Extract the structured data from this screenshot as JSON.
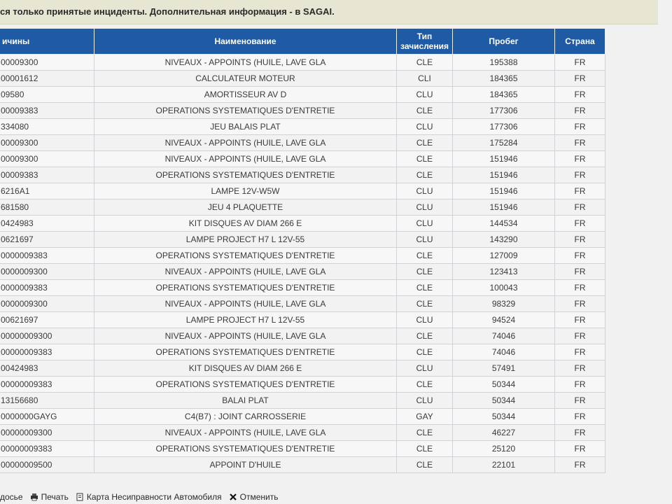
{
  "notice": "ся только принятые инциденты. Дополнительная информация - в SAGAI.",
  "table": {
    "headers": [
      "ичины",
      "Наименование",
      "Тип\nзачисления",
      "Пробег",
      "Страна"
    ],
    "rows": [
      [
        "00009300",
        "NIVEAUX - APPOINTS (HUILE, LAVE GLA",
        "CLE",
        "195388",
        "FR"
      ],
      [
        "00001612",
        "CALCULATEUR MOTEUR",
        "CLI",
        "184365",
        "FR"
      ],
      [
        "09580",
        "AMORTISSEUR AV D",
        "CLU",
        "184365",
        "FR"
      ],
      [
        "00009383",
        "OPERATIONS SYSTEMATIQUES D'ENTRETIE",
        "CLE",
        "177306",
        "FR"
      ],
      [
        "334080",
        "JEU BALAIS PLAT",
        "CLU",
        "177306",
        "FR"
      ],
      [
        "00009300",
        "NIVEAUX - APPOINTS (HUILE, LAVE GLA",
        "CLE",
        "175284",
        "FR"
      ],
      [
        "00009300",
        "NIVEAUX - APPOINTS (HUILE, LAVE GLA",
        "CLE",
        "151946",
        "FR"
      ],
      [
        "00009383",
        "OPERATIONS SYSTEMATIQUES D'ENTRETIE",
        "CLE",
        "151946",
        "FR"
      ],
      [
        "6216A1",
        "LAMPE 12V-W5W",
        "CLU",
        "151946",
        "FR"
      ],
      [
        "681580",
        "JEU 4 PLAQUETTE",
        "CLU",
        "151946",
        "FR"
      ],
      [
        "0424983",
        "KIT DISQUES AV DIAM 266 E",
        "CLU",
        "144534",
        "FR"
      ],
      [
        "0621697",
        "LAMPE PROJECT H7 L 12V-55",
        "CLU",
        "143290",
        "FR"
      ],
      [
        "0000009383",
        "OPERATIONS SYSTEMATIQUES D'ENTRETIE",
        "CLE",
        "127009",
        "FR"
      ],
      [
        "0000009300",
        "NIVEAUX - APPOINTS (HUILE, LAVE GLA",
        "CLE",
        "123413",
        "FR"
      ],
      [
        "0000009383",
        "OPERATIONS SYSTEMATIQUES D'ENTRETIE",
        "CLE",
        "100043",
        "FR"
      ],
      [
        "0000009300",
        "NIVEAUX - APPOINTS (HUILE, LAVE GLA",
        "CLE",
        "98329",
        "FR"
      ],
      [
        "00621697",
        "LAMPE PROJECT H7 L 12V-55",
        "CLU",
        "94524",
        "FR"
      ],
      [
        "00000009300",
        "NIVEAUX - APPOINTS (HUILE, LAVE GLA",
        "CLE",
        "74046",
        "FR"
      ],
      [
        "00000009383",
        "OPERATIONS SYSTEMATIQUES D'ENTRETIE",
        "CLE",
        "74046",
        "FR"
      ],
      [
        "00424983",
        "KIT DISQUES AV DIAM 266 E",
        "CLU",
        "57491",
        "FR"
      ],
      [
        "00000009383",
        "OPERATIONS SYSTEMATIQUES D'ENTRETIE",
        "CLE",
        "50344",
        "FR"
      ],
      [
        "13156680",
        "BALAI PLAT",
        "CLU",
        "50344",
        "FR"
      ],
      [
        "0000000GAYG",
        "C4(B7) : JOINT CARROSSERIE",
        "GAY",
        "50344",
        "FR"
      ],
      [
        "00000009300",
        "NIVEAUX - APPOINTS (HUILE, LAVE GLA",
        "CLE",
        "46227",
        "FR"
      ],
      [
        "00000009383",
        "OPERATIONS SYSTEMATIQUES D'ENTRETIE",
        "CLE",
        "25120",
        "FR"
      ],
      [
        "00000009500",
        "APPOINT D'HUILE",
        "CLE",
        "22101",
        "FR"
      ]
    ]
  },
  "footer": {
    "dossier": "досье",
    "print": "Печать",
    "card": "Карта Несиправности Автомобиля",
    "cancel": "Отменить"
  },
  "icons": {
    "print": "printer-icon",
    "card": "document-icon",
    "cancel": "close-icon"
  },
  "colors": {
    "header_bg": "#1f5aa4",
    "notice_bg": "#e6e6d2"
  }
}
